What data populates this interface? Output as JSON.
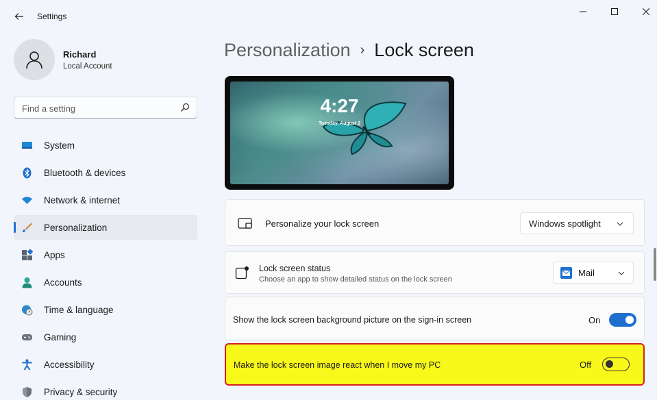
{
  "window": {
    "title": "Settings"
  },
  "profile": {
    "name": "Richard",
    "account_type": "Local Account"
  },
  "search": {
    "placeholder": "Find a setting"
  },
  "sidebar": {
    "items": [
      {
        "label": "System",
        "icon": "monitor-icon",
        "active": false
      },
      {
        "label": "Bluetooth & devices",
        "icon": "bluetooth-icon",
        "active": false
      },
      {
        "label": "Network & internet",
        "icon": "wifi-icon",
        "active": false
      },
      {
        "label": "Personalization",
        "icon": "brush-icon",
        "active": true
      },
      {
        "label": "Apps",
        "icon": "apps-icon",
        "active": false
      },
      {
        "label": "Accounts",
        "icon": "person-icon",
        "active": false
      },
      {
        "label": "Time & language",
        "icon": "globe-clock-icon",
        "active": false
      },
      {
        "label": "Gaming",
        "icon": "gamepad-icon",
        "active": false
      },
      {
        "label": "Accessibility",
        "icon": "accessibility-icon",
        "active": false
      },
      {
        "label": "Privacy & security",
        "icon": "shield-icon",
        "active": false
      }
    ]
  },
  "breadcrumb": {
    "parent": "Personalization",
    "separator": "›",
    "current": "Lock screen"
  },
  "preview": {
    "time": "4:27",
    "date": "Tuesday, August 2"
  },
  "settings": {
    "personalize": {
      "title": "Personalize your lock screen",
      "value": "Windows spotlight"
    },
    "status": {
      "title": "Lock screen status",
      "description": "Choose an app to show detailed status on the lock screen",
      "value": "Mail"
    },
    "signin_background": {
      "title": "Show the lock screen background picture on the sign-in screen",
      "state": "On"
    },
    "react_motion": {
      "title": "Make the lock screen image react when I move my PC",
      "state": "Off"
    }
  },
  "colors": {
    "accent": "#1e6fd0",
    "highlight": "#f8f81a",
    "highlight_border": "#d82020"
  }
}
